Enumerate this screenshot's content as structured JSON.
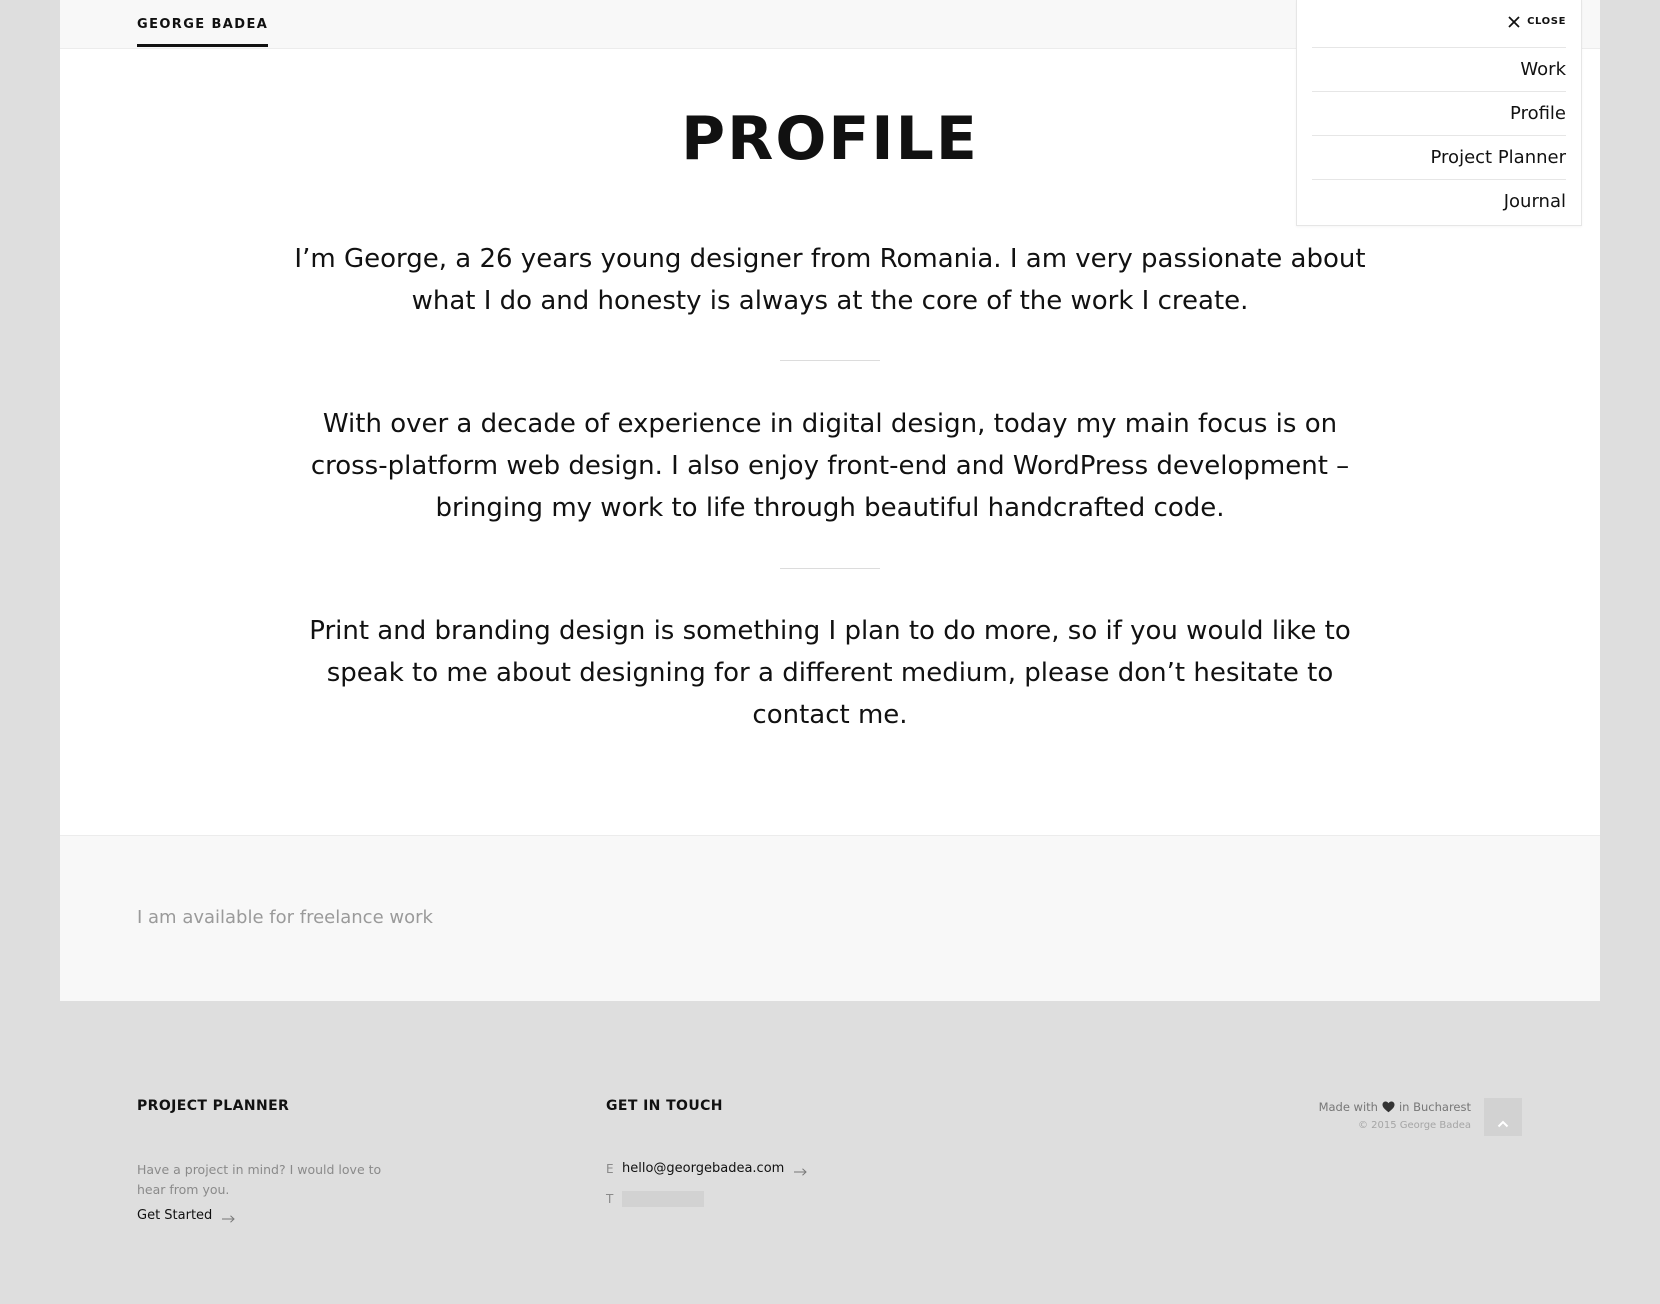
{
  "header": {
    "brand": "GEORGE BADEA"
  },
  "menu": {
    "close_label": "CLOSE",
    "items": [
      {
        "label": "Work"
      },
      {
        "label": "Profile"
      },
      {
        "label": "Project Planner"
      },
      {
        "label": "Journal"
      }
    ]
  },
  "main": {
    "title": "PROFILE",
    "paragraphs": [
      "I’m George, a 26 years young designer from Romania. I am very passionate about what I do and honesty is always at the core of the work I create.",
      "With over a decade of experience in digital design, today my main focus is on cross-platform web design. I also enjoy front-end and WordPress development – bringing my work to life through beautiful handcrafted code.",
      "Print and branding design is something I plan to do more, so if you would like to speak to me about designing for a different medium, please don’t hesitate to contact me."
    ]
  },
  "freelance": {
    "text": "I am available for freelance work"
  },
  "footer": {
    "planner": {
      "heading": "PROJECT PLANNER",
      "description": "Have a project in mind? I would love to hear from you.",
      "cta": "Get Started"
    },
    "contact": {
      "heading": "GET IN TOUCH",
      "email_key": "E",
      "email": "hello@georgebadea.com",
      "phone_key": "T"
    },
    "credits": {
      "made_with_prefix": "Made with",
      "made_with_suffix": "in Bucharest",
      "copyright": "© 2015 George Badea"
    }
  },
  "icons": {
    "close": "close-icon",
    "heart": "heart-icon",
    "arrow": "arrow-right-icon",
    "to_top": "chevron-up-icon"
  },
  "colors": {
    "page_bg": "#dedede",
    "panel_bg": "#ffffff",
    "subtle_bg": "#f8f8f8",
    "text": "#111111",
    "muted": "#9a9a9a"
  }
}
